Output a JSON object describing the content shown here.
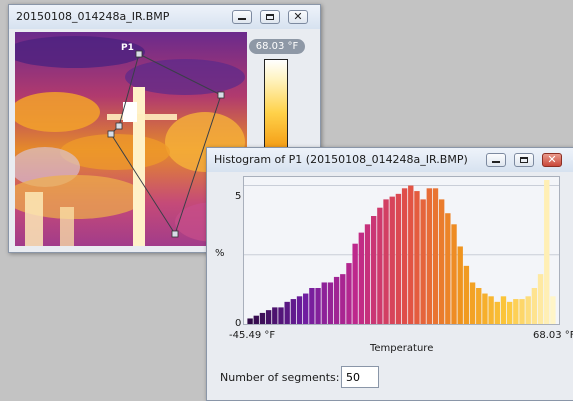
{
  "ir_window": {
    "title": "20150108_014248a_IR.BMP",
    "roi_label": "P1",
    "max_temp": "68.03 °F",
    "controls": {
      "minimize": "minimize-icon",
      "maximize": "maximize-icon",
      "close": "close-icon"
    }
  },
  "histogram_window": {
    "title": "Histogram of P1 (20150108_014248a_IR.BMP)",
    "y_axis_label": "%",
    "y_ticks": [
      "5",
      "0"
    ],
    "x_axis_label": "Temperature",
    "x_min_label": "-45.49 °F",
    "x_max_label": "68.03 °F",
    "segments_label": "Number of segments:",
    "segments_value": "50"
  },
  "colors": {
    "accent": "#f5a21a",
    "close_button": "#c9483a"
  },
  "chart_data": {
    "type": "bar",
    "x_range": [
      -45.49,
      68.03
    ],
    "bins": 50,
    "ylim": [
      0,
      5.2
    ],
    "values": [
      0.2,
      0.3,
      0.4,
      0.5,
      0.6,
      0.6,
      0.8,
      0.9,
      1.0,
      1.1,
      1.3,
      1.3,
      1.5,
      1.5,
      1.7,
      1.8,
      2.2,
      2.9,
      3.3,
      3.6,
      3.9,
      4.2,
      4.5,
      4.6,
      4.7,
      4.9,
      5.0,
      4.8,
      4.5,
      4.9,
      4.9,
      4.5,
      4.0,
      3.6,
      2.8,
      2.1,
      1.5,
      1.3,
      1.1,
      1.0,
      0.8,
      1.0,
      0.8,
      0.9,
      0.9,
      1.0,
      1.3,
      1.8,
      5.3,
      1.0
    ]
  }
}
